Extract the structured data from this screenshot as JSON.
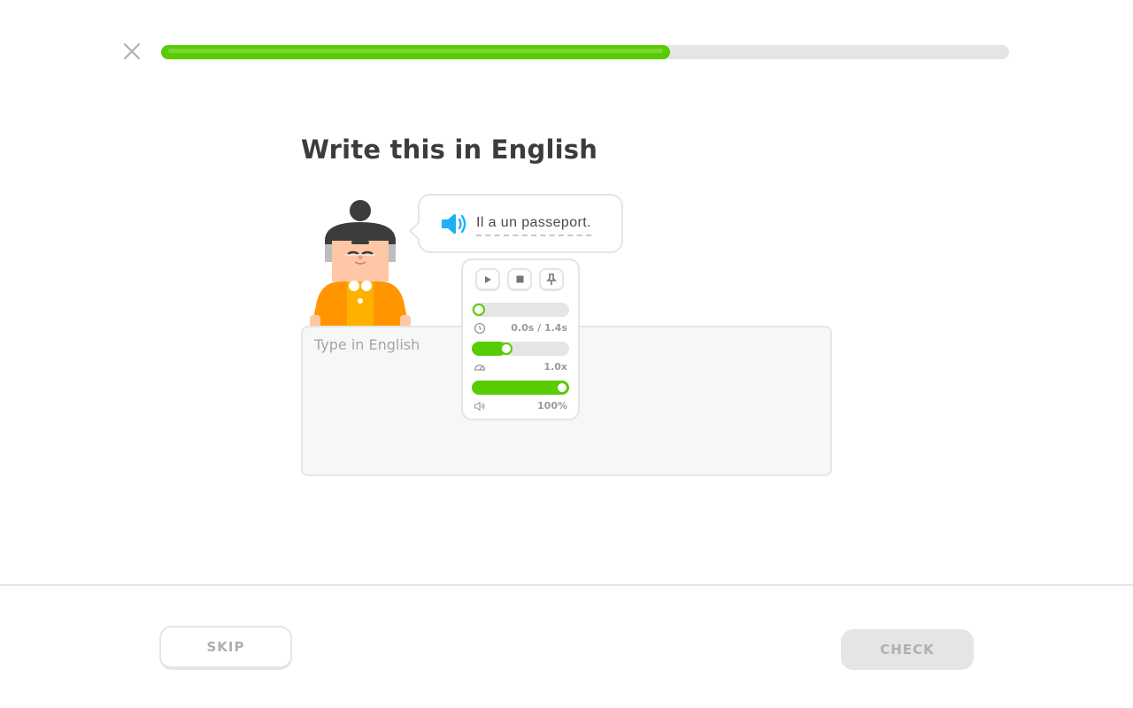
{
  "header": {
    "close_icon": "close-icon",
    "progress": 0.6
  },
  "prompt": {
    "title": "Write this in English"
  },
  "speech": {
    "speaker_icon": "speaker-icon",
    "sentence": "Il a un passeport."
  },
  "audio_panel": {
    "play_icon": "play-icon",
    "stop_icon": "stop-icon",
    "pin_icon": "pin-icon",
    "time_icon": "clock-icon",
    "time_text": "0.0s / 1.4s",
    "time_position": 0.0,
    "speed_icon": "speedometer-icon",
    "speed_text": "1.0x",
    "speed_level": 0.35,
    "volume_icon": "volume-icon",
    "volume_text": "100%",
    "volume_level": 1.0
  },
  "answer": {
    "placeholder": "Type in English",
    "value": ""
  },
  "footer": {
    "skip_label": "SKIP",
    "check_label": "CHECK"
  },
  "colors": {
    "accent": "#58cc02",
    "speaker": "#1cb0f6",
    "character_shirt": "#ff9600"
  }
}
